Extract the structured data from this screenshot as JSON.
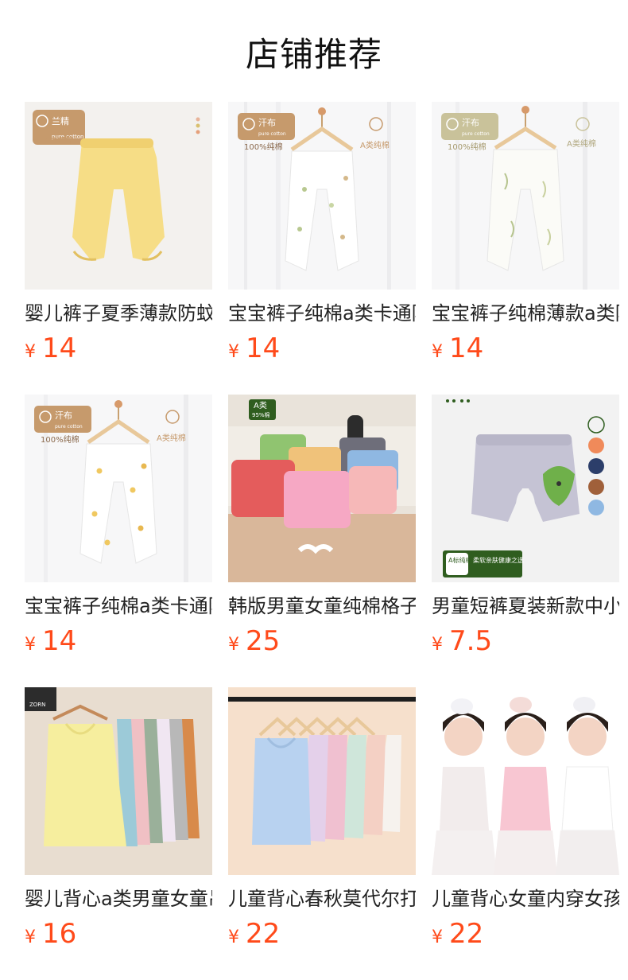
{
  "header": {
    "title": "店铺推荐"
  },
  "currency_symbol": "¥",
  "products": [
    {
      "name": "婴儿裤子夏季薄款防蚊裤",
      "price": "14",
      "image": {
        "badge_top": "兰精",
        "badge_bottom": "A类精棉",
        "badge_sub": "pure cotton"
      }
    },
    {
      "name": "宝宝裤子纯棉a类卡通防蚊",
      "price": "14",
      "image": {
        "badge_top": "汗布",
        "badge_bottom": "100%纯棉",
        "badge_sub": "pure cotton",
        "right_tag": "A类纯棉"
      }
    },
    {
      "name": "宝宝裤子纯棉薄款a类防蚊",
      "price": "14",
      "image": {
        "badge_top": "汗布",
        "badge_bottom": "100%纯棉",
        "badge_sub": "pure cotton",
        "right_tag": "A类纯棉"
      }
    },
    {
      "name": "宝宝裤子纯棉a类卡通防蚊",
      "price": "14",
      "image": {
        "badge_top": "汗布",
        "badge_bottom": "100%纯棉",
        "badge_sub": "pure cotton",
        "right_tag": "A类纯棉"
      }
    },
    {
      "name": "韩版男童女童纯棉格子短裤",
      "price": "25",
      "image": {
        "badge_top": "A类",
        "badge_bottom": "95%棉"
      }
    },
    {
      "name": "男童短裤夏装新款中小童",
      "price": "7.5",
      "image": {
        "badge_left": "A标纯棉",
        "badge_right": "柔软亲肤健康之选"
      }
    },
    {
      "name": "婴儿背心a类男童女童吊带",
      "price": "16",
      "image": {
        "logo": "ZORN"
      }
    },
    {
      "name": "儿童背心春秋莫代尔打底",
      "price": "22",
      "image": {}
    },
    {
      "name": "儿童背心女童内穿女孩吊带",
      "price": "22",
      "image": {}
    }
  ],
  "colors": {
    "price": "#ff4a1a",
    "pants_yellow": "#f6dd86",
    "badge_brown": "#c69a6c",
    "badge_green": "#2f5d1f"
  }
}
